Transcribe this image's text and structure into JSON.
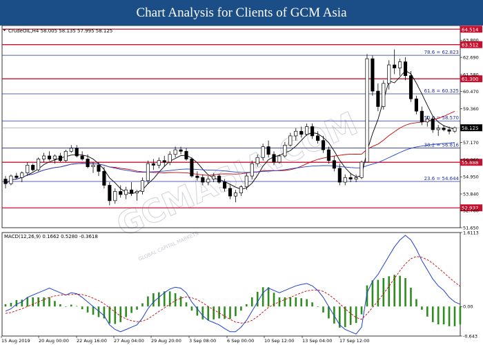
{
  "header": {
    "title": "Chart Analysis for Clients of GCM Asia"
  },
  "watermark": {
    "text": "GCMASIA.COM",
    "subtext": "GLOBAL CAPITAL MARKETS"
  },
  "colors": {
    "header_bg": "#1b4d86",
    "candle": "#000000",
    "sma_fast": "#000000",
    "ma_red": "#cc0000",
    "ma_blue": "#1f3fcf",
    "level_red": "#c8102e",
    "fib_blue": "#1f2f9f",
    "macd_line": "#1f3fcf",
    "signal_line": "#cc0000",
    "histogram": "#2e8b1f"
  },
  "chart_data": [
    {
      "type": "candlestick",
      "title": "CrudeOIL,H4  58.005 58.135 57.995 58.125",
      "ylim": [
        51.65,
        64.75
      ],
      "yticks": [
        51.65,
        52.76,
        53.84,
        54.95,
        56.06,
        57.17,
        58.25,
        59.36,
        60.47,
        61.58,
        62.69,
        63.8
      ],
      "current_price": 58.125,
      "ohlc": [
        [
          54.8,
          55.0,
          54.2,
          54.5
        ],
        [
          54.5,
          55.1,
          54.4,
          55.0
        ],
        [
          55.0,
          55.2,
          54.8,
          54.9
        ],
        [
          54.9,
          55.3,
          54.6,
          55.2
        ],
        [
          55.2,
          55.9,
          55.0,
          55.7
        ],
        [
          55.7,
          55.8,
          55.3,
          55.4
        ],
        [
          55.4,
          56.2,
          55.3,
          56.1
        ],
        [
          56.1,
          56.5,
          55.9,
          56.3
        ],
        [
          56.3,
          56.6,
          56.0,
          56.1
        ],
        [
          56.1,
          56.4,
          55.8,
          56.3
        ],
        [
          56.3,
          56.5,
          55.9,
          56.0
        ],
        [
          56.0,
          56.7,
          55.9,
          56.6
        ],
        [
          56.6,
          57.0,
          56.5,
          56.8
        ],
        [
          56.8,
          57.0,
          56.2,
          56.3
        ],
        [
          56.3,
          56.6,
          56.0,
          56.1
        ],
        [
          56.1,
          56.4,
          55.5,
          55.6
        ],
        [
          55.6,
          55.9,
          55.2,
          55.7
        ],
        [
          55.7,
          55.9,
          55.0,
          55.3
        ],
        [
          55.3,
          55.6,
          54.2,
          54.4
        ],
        [
          54.4,
          54.6,
          53.1,
          53.4
        ],
        [
          53.4,
          54.2,
          53.2,
          54.0
        ],
        [
          54.0,
          54.4,
          53.6,
          53.8
        ],
        [
          53.8,
          54.3,
          53.5,
          54.1
        ],
        [
          54.1,
          54.6,
          53.7,
          53.9
        ],
        [
          53.9,
          54.1,
          53.4,
          54.0
        ],
        [
          54.0,
          54.9,
          53.8,
          54.7
        ],
        [
          54.7,
          56.0,
          54.5,
          55.8
        ],
        [
          55.8,
          56.1,
          55.4,
          55.7
        ],
        [
          55.7,
          56.2,
          55.5,
          56.0
        ],
        [
          56.0,
          56.3,
          55.6,
          55.9
        ],
        [
          55.9,
          56.6,
          55.7,
          56.4
        ],
        [
          56.4,
          56.9,
          56.2,
          56.7
        ],
        [
          56.7,
          56.9,
          56.4,
          56.6
        ],
        [
          56.6,
          56.8,
          56.0,
          56.1
        ],
        [
          56.1,
          56.2,
          54.9,
          55.0
        ],
        [
          55.0,
          55.3,
          54.7,
          54.9
        ],
        [
          54.9,
          55.1,
          54.4,
          54.6
        ],
        [
          54.6,
          55.0,
          54.4,
          54.8
        ],
        [
          54.8,
          55.2,
          54.6,
          55.0
        ],
        [
          55.0,
          55.1,
          54.5,
          54.6
        ],
        [
          54.6,
          54.8,
          54.0,
          54.2
        ],
        [
          54.2,
          54.4,
          53.5,
          53.7
        ],
        [
          53.7,
          54.1,
          53.3,
          53.9
        ],
        [
          53.9,
          54.4,
          53.7,
          54.3
        ],
        [
          54.3,
          55.2,
          54.1,
          55.0
        ],
        [
          55.0,
          56.0,
          54.8,
          55.8
        ],
        [
          55.8,
          56.4,
          55.6,
          56.2
        ],
        [
          56.2,
          57.1,
          56.0,
          56.9
        ],
        [
          56.9,
          57.3,
          56.2,
          56.4
        ],
        [
          56.4,
          56.6,
          55.7,
          55.9
        ],
        [
          55.9,
          56.4,
          55.8,
          56.3
        ],
        [
          56.3,
          57.2,
          56.2,
          57.0
        ],
        [
          57.0,
          57.8,
          56.9,
          57.6
        ],
        [
          57.6,
          58.1,
          57.3,
          57.9
        ],
        [
          57.9,
          58.2,
          57.5,
          57.7
        ],
        [
          57.7,
          58.4,
          57.6,
          58.2
        ],
        [
          58.2,
          58.4,
          57.4,
          57.6
        ],
        [
          57.6,
          57.9,
          57.1,
          57.3
        ],
        [
          57.3,
          57.6,
          56.5,
          56.7
        ],
        [
          56.7,
          56.9,
          55.8,
          56.0
        ],
        [
          56.0,
          56.3,
          55.3,
          55.5
        ],
        [
          55.5,
          55.8,
          54.4,
          54.6
        ],
        [
          54.6,
          55.1,
          54.4,
          54.9
        ],
        [
          54.9,
          55.2,
          54.6,
          54.8
        ],
        [
          54.8,
          55.1,
          54.6,
          54.9
        ],
        [
          54.9,
          56.0,
          54.8,
          55.9
        ],
        [
          55.9,
          62.9,
          55.9,
          62.6
        ],
        [
          62.6,
          62.8,
          60.2,
          60.5
        ],
        [
          60.5,
          61.0,
          59.2,
          59.5
        ],
        [
          59.5,
          61.2,
          59.3,
          61.0
        ],
        [
          61.0,
          62.5,
          60.6,
          62.2
        ],
        [
          62.2,
          63.2,
          61.6,
          62.0
        ],
        [
          62.0,
          62.6,
          61.5,
          62.4
        ],
        [
          62.4,
          62.7,
          61.2,
          61.5
        ],
        [
          61.5,
          61.8,
          59.8,
          60.0
        ],
        [
          60.0,
          60.2,
          59.0,
          59.2
        ],
        [
          59.2,
          59.5,
          58.3,
          58.5
        ],
        [
          58.5,
          58.9,
          58.2,
          58.7
        ],
        [
          58.7,
          58.8,
          57.8,
          58.0
        ],
        [
          58.0,
          58.3,
          57.6,
          58.1
        ],
        [
          58.1,
          58.3,
          57.9,
          58.0
        ],
        [
          58.0,
          58.2,
          57.7,
          57.9
        ],
        [
          57.9,
          58.2,
          57.8,
          58.13
        ]
      ],
      "moving_average_periods": [
        5,
        20,
        50
      ],
      "horizontal_levels": [
        {
          "label": "64.514",
          "value": 64.514,
          "color": "red",
          "style": "price_box"
        },
        {
          "label": "63.512",
          "value": 63.512,
          "color": "red",
          "style": "price_box"
        },
        {
          "label": "61.300",
          "value": 61.3,
          "color": "red",
          "style": "price_box"
        },
        {
          "label": "55.888",
          "value": 55.888,
          "color": "red",
          "style": "price_box"
        },
        {
          "label": "52.937",
          "value": 52.937,
          "color": "red",
          "style": "price_box"
        },
        {
          "label": "78.6 = 62.823",
          "value": 62.823,
          "color": "blue",
          "style": "fib"
        },
        {
          "label": "61.8 = 60.325",
          "value": 60.325,
          "color": "blue",
          "style": "fib"
        },
        {
          "label": "50.0 = 58.570",
          "value": 58.57,
          "color": "blue",
          "style": "fib"
        },
        {
          "label": "38.2 = 56.816",
          "value": 56.816,
          "color": "blue",
          "style": "fib"
        },
        {
          "label": "23.6 = 54.644",
          "value": 54.644,
          "color": "blue",
          "style": "fib"
        }
      ]
    },
    {
      "type": "macd",
      "title": "MACD(12,26,9) 0.1662 0.5280 -0.3618",
      "ylim": [
        -0.643,
        1.6113
      ],
      "yticks": [
        1.6113,
        0.0,
        -0.643
      ],
      "macd": [
        -0.1,
        -0.05,
        0.05,
        0.1,
        0.2,
        0.25,
        0.3,
        0.35,
        0.4,
        0.35,
        0.3,
        0.25,
        0.3,
        0.28,
        0.2,
        0.1,
        0.0,
        -0.1,
        -0.2,
        -0.4,
        -0.5,
        -0.55,
        -0.5,
        -0.45,
        -0.4,
        -0.25,
        -0.05,
        0.1,
        0.2,
        0.3,
        0.38,
        0.42,
        0.4,
        0.3,
        0.1,
        -0.05,
        -0.2,
        -0.3,
        -0.35,
        -0.4,
        -0.48,
        -0.55,
        -0.55,
        -0.45,
        -0.3,
        -0.1,
        0.1,
        0.3,
        0.4,
        0.35,
        0.3,
        0.35,
        0.4,
        0.45,
        0.48,
        0.5,
        0.45,
        0.35,
        0.2,
        0.0,
        -0.2,
        -0.4,
        -0.5,
        -0.55,
        -0.6,
        -0.45,
        0.3,
        0.55,
        0.7,
        0.9,
        1.1,
        1.3,
        1.45,
        1.55,
        1.45,
        1.25,
        1.0,
        0.8,
        0.6,
        0.45,
        0.35,
        0.2,
        0.1,
        0.05
      ],
      "signal": [
        -0.15,
        -0.13,
        -0.09,
        -0.05,
        0.0,
        0.05,
        0.1,
        0.15,
        0.2,
        0.23,
        0.25,
        0.25,
        0.26,
        0.27,
        0.26,
        0.23,
        0.18,
        0.13,
        0.06,
        -0.03,
        -0.12,
        -0.21,
        -0.27,
        -0.31,
        -0.33,
        -0.32,
        -0.27,
        -0.19,
        -0.11,
        -0.03,
        0.05,
        0.13,
        0.18,
        0.21,
        0.19,
        0.15,
        0.08,
        0.0,
        -0.07,
        -0.14,
        -0.21,
        -0.28,
        -0.34,
        -0.36,
        -0.35,
        -0.3,
        -0.22,
        -0.12,
        -0.02,
        0.05,
        0.1,
        0.15,
        0.2,
        0.25,
        0.3,
        0.34,
        0.36,
        0.36,
        0.33,
        0.26,
        0.17,
        0.06,
        -0.05,
        -0.15,
        -0.24,
        -0.28,
        -0.16,
        -0.02,
        0.12,
        0.28,
        0.44,
        0.61,
        0.78,
        0.93,
        1.04,
        1.09,
        1.07,
        1.02,
        0.94,
        0.84,
        0.74,
        0.63,
        0.53,
        0.44
      ],
      "x_labels": [
        "15 Aug 2019",
        "20 Aug 00:00",
        "22 Aug 16:00",
        "27 Aug 04:00",
        "29 Aug 20:00",
        "3 Sep 08:00",
        "6 Sep 00:00",
        "10 Sep 12:00",
        "13 Sep 04:00",
        "17 Sep 12:00"
      ]
    }
  ]
}
